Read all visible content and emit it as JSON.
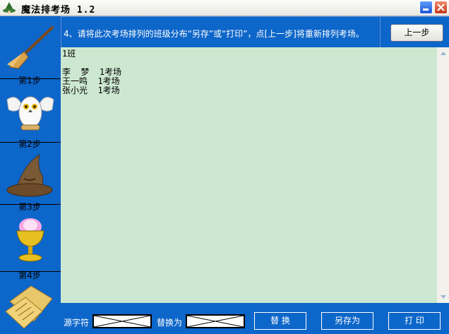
{
  "window": {
    "title": "魔法排考场 1.2",
    "app_icon": "wizard-app-icon",
    "minimize_icon": "minimize-icon",
    "close_icon": "close-icon"
  },
  "sidebar": {
    "steps": [
      {
        "label": "第1步",
        "icon": "broom-icon"
      },
      {
        "label": "第2步",
        "icon": "owl-icon"
      },
      {
        "label": "第3步",
        "icon": "sorting-hat-icon"
      },
      {
        "label": "第4步",
        "icon": "goblet-icon"
      },
      {
        "label": "",
        "icon": "parchment-icon"
      }
    ]
  },
  "instruction": "4、请将此次考场排列的班级分布“另存”或“打印”，点[上一步]将重新排列考场。",
  "prev_button": "上一步",
  "output_text": "1班\n\n李  梦  1考场\n王一鸣  1考场\n张小光  1考场",
  "bottom": {
    "source_label": "源字符",
    "replace_label": "替换为",
    "replace_button": "替  换",
    "save_as_button": "另存为",
    "print_button": "打  印"
  },
  "colors": {
    "background": "#0d66c9",
    "textarea": "#cde8d0"
  }
}
